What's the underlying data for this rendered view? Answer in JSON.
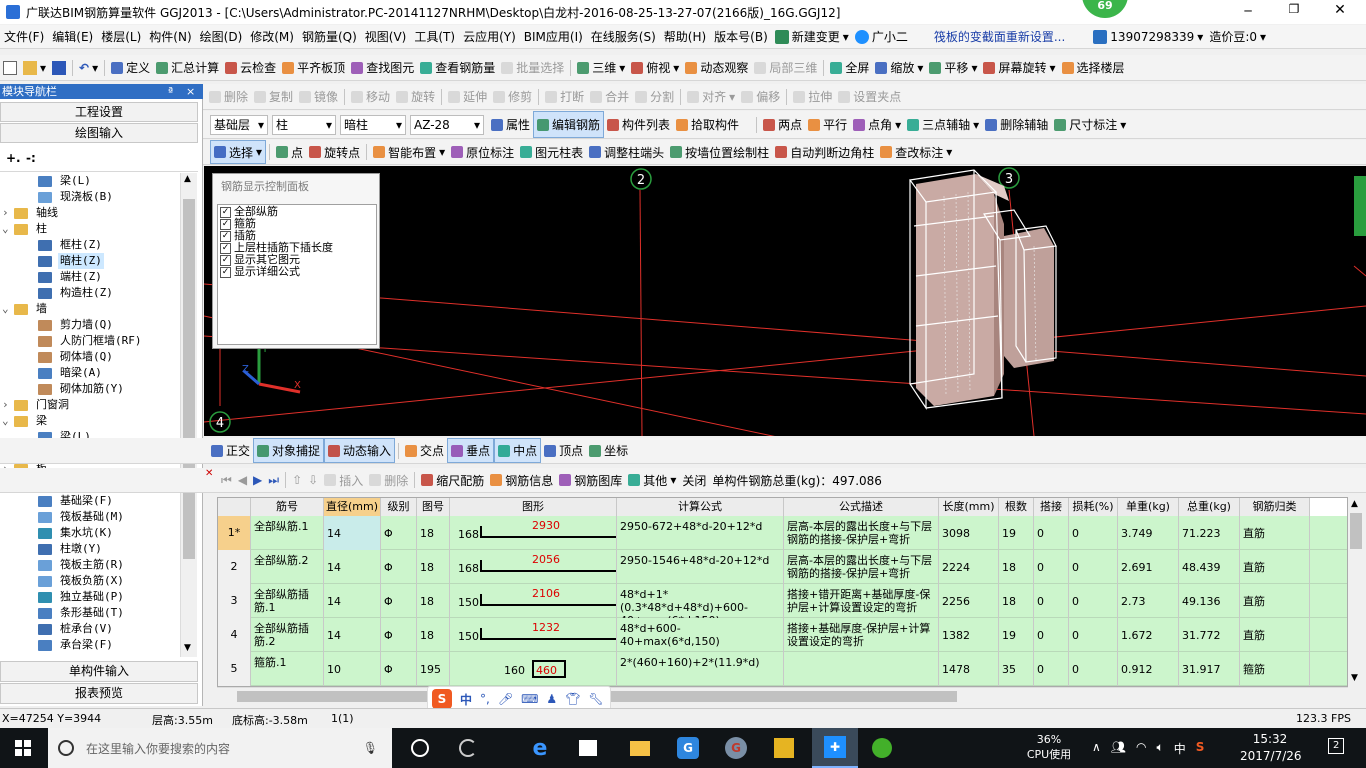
{
  "title": "广联达BIM钢筋算量软件 GGJ2013 - [C:\\Users\\Administrator.PC-20141127NRHM\\Desktop\\白龙村-2016-08-25-13-27-07(2166版)_16G.GGJ12]",
  "badge": "69",
  "menu": [
    "文件(F)",
    "编辑(E)",
    "楼层(L)",
    "构件(N)",
    "绘图(D)",
    "修改(M)",
    "钢筋量(Q)",
    "视图(V)",
    "工具(T)",
    "云应用(Y)",
    "BIM应用(I)",
    "在线服务(S)",
    "帮助(H)",
    "版本号(B)"
  ],
  "menu_new_change": "新建变更",
  "menu_assistant": "广小二",
  "menu_tip": "筏板的变截面重新设置...",
  "menu_phone": "13907298339",
  "menu_cost": "造价豆:0",
  "toolbar1": [
    "定义",
    "汇总计算",
    "云检查",
    "平齐板顶",
    "查找图元",
    "查看钢筋量",
    "批量选择",
    "三维",
    "俯视",
    "动态观察",
    "局部三维",
    "全屏",
    "缩放",
    "平移",
    "屏幕旋转",
    "选择楼层"
  ],
  "toolbar2": [
    "删除",
    "复制",
    "镜像",
    "移动",
    "旋转",
    "延伸",
    "修剪",
    "打断",
    "合并",
    "分割",
    "对齐",
    "偏移",
    "拉伸",
    "设置夹点"
  ],
  "toolbar3": {
    "floor": "基础层",
    "type": "柱",
    "sub": "暗柱",
    "name": "AZ-28",
    "items": [
      "属性",
      "编辑钢筋",
      "构件列表",
      "拾取构件"
    ],
    "items2": [
      "两点",
      "平行",
      "点角",
      "三点辅轴",
      "删除辅轴",
      "尺寸标注"
    ]
  },
  "toolbar4": [
    "选择",
    "点",
    "旋转点",
    "智能布置",
    "原位标注",
    "图元柱表",
    "调整柱端头",
    "按墙位置绘制柱",
    "自动判断边角柱",
    "查改标注"
  ],
  "nav": {
    "title": "模块导航栏",
    "pin": "ª",
    "close": "×",
    "btn1": "工程设置",
    "btn2": "绘图输入",
    "btn3": "单构件输入",
    "btn4": "报表预览"
  },
  "tree": [
    {
      "t": "梁(L)",
      "lvl": 3,
      "ico": "beam"
    },
    {
      "t": "现浇板(B)",
      "lvl": 3,
      "ico": "slab"
    },
    {
      "t": "轴线",
      "lvl": 1,
      "ico": "folder",
      "exp": "+"
    },
    {
      "t": "柱",
      "lvl": 1,
      "ico": "folder",
      "exp": "-"
    },
    {
      "t": "框柱(Z)",
      "lvl": 2,
      "ico": "col"
    },
    {
      "t": "暗柱(Z)",
      "lvl": 2,
      "ico": "col",
      "sel": true
    },
    {
      "t": "端柱(Z)",
      "lvl": 2,
      "ico": "col"
    },
    {
      "t": "构造柱(Z)",
      "lvl": 2,
      "ico": "col"
    },
    {
      "t": "墙",
      "lvl": 1,
      "ico": "folder",
      "exp": "-"
    },
    {
      "t": "剪力墙(Q)",
      "lvl": 2,
      "ico": "wall"
    },
    {
      "t": "人防门框墙(RF)",
      "lvl": 2,
      "ico": "wall"
    },
    {
      "t": "砌体墙(Q)",
      "lvl": 2,
      "ico": "wall"
    },
    {
      "t": "暗梁(A)",
      "lvl": 2,
      "ico": "beam"
    },
    {
      "t": "砌体加筋(Y)",
      "lvl": 2,
      "ico": "wall"
    },
    {
      "t": "门窗洞",
      "lvl": 1,
      "ico": "folder",
      "exp": "+"
    },
    {
      "t": "梁",
      "lvl": 1,
      "ico": "folder",
      "exp": "-"
    },
    {
      "t": "梁(L)",
      "lvl": 2,
      "ico": "beam"
    },
    {
      "t": "圈梁(E)",
      "lvl": 2,
      "ico": "beam"
    },
    {
      "t": "板",
      "lvl": 1,
      "ico": "folder",
      "exp": "+"
    },
    {
      "t": "基础",
      "lvl": 1,
      "ico": "folder",
      "exp": "-"
    },
    {
      "t": "基础梁(F)",
      "lvl": 2,
      "ico": "beam"
    },
    {
      "t": "筏板基础(M)",
      "lvl": 2,
      "ico": "slab"
    },
    {
      "t": "集水坑(K)",
      "lvl": 2,
      "ico": "pit"
    },
    {
      "t": "柱墩(Y)",
      "lvl": 2,
      "ico": "col"
    },
    {
      "t": "筏板主筋(R)",
      "lvl": 2,
      "ico": "slab"
    },
    {
      "t": "筏板负筋(X)",
      "lvl": 2,
      "ico": "slab"
    },
    {
      "t": "独立基础(P)",
      "lvl": 2,
      "ico": "pit"
    },
    {
      "t": "条形基础(T)",
      "lvl": 2,
      "ico": "beam"
    },
    {
      "t": "桩承台(V)",
      "lvl": 2,
      "ico": "col"
    },
    {
      "t": "承台梁(F)",
      "lvl": 2,
      "ico": "beam"
    }
  ],
  "panel": {
    "title": "钢筋显示控制面板",
    "items": [
      "全部纵筋",
      "箍筋",
      "插筋",
      "上层柱插筋下插长度",
      "显示其它图元",
      "显示详细公式"
    ]
  },
  "axis_labels": [
    "2",
    "3",
    "4"
  ],
  "snapbar": [
    "正交",
    "对象捕捉",
    "动态输入",
    "交点",
    "垂点",
    "中点",
    "顶点",
    "坐标"
  ],
  "gridbar": {
    "items": [
      "插入",
      "删除",
      "缩尺配筋",
      "钢筋信息",
      "钢筋图库",
      "其他",
      "关闭"
    ],
    "total": "单构件钢筋总重(kg)：497.086"
  },
  "columns": [
    "筋号",
    "直径(mm)",
    "级别",
    "图号",
    "图形",
    "计算公式",
    "公式描述",
    "长度(mm)",
    "根数",
    "搭接",
    "损耗(%)",
    "单重(kg)",
    "总重(kg)",
    "钢筋归类"
  ],
  "rows": [
    {
      "no": "1*",
      "name": "全部纵筋.1",
      "d": "14",
      "lvl": "Φ",
      "fig": "18",
      "s1": "168",
      "s2": "2930",
      "formula": "2950-672+48*d-20+12*d",
      "desc": "层高-本层的露出长度+与下层钢筋的搭接-保护层+弯折",
      "len": "3098",
      "cnt": "19",
      "lap": "0",
      "loss": "0",
      "uw": "3.749",
      "tw": "71.223",
      "cat": "直筋"
    },
    {
      "no": "2",
      "name": "全部纵筋.2",
      "d": "14",
      "lvl": "Φ",
      "fig": "18",
      "s1": "168",
      "s2": "2056",
      "formula": "2950-1546+48*d-20+12*d",
      "desc": "层高-本层的露出长度+与下层钢筋的搭接-保护层+弯折",
      "len": "2224",
      "cnt": "18",
      "lap": "0",
      "loss": "0",
      "uw": "2.691",
      "tw": "48.439",
      "cat": "直筋"
    },
    {
      "no": "3",
      "name": "全部纵筋插筋.1",
      "d": "14",
      "lvl": "Φ",
      "fig": "18",
      "s1": "150",
      "s2": "2106",
      "formula": "48*d+1*(0.3*48*d+48*d)+600-40+max(6*d,150)",
      "desc": "搭接+错开距离+基础厚度-保护层+计算设置设定的弯折",
      "len": "2256",
      "cnt": "18",
      "lap": "0",
      "loss": "0",
      "uw": "2.73",
      "tw": "49.136",
      "cat": "直筋"
    },
    {
      "no": "4",
      "name": "全部纵筋插筋.2",
      "d": "14",
      "lvl": "Φ",
      "fig": "18",
      "s1": "150",
      "s2": "1232",
      "formula": "48*d+600-40+max(6*d,150)",
      "desc": "搭接+基础厚度-保护层+计算设置设定的弯折",
      "len": "1382",
      "cnt": "19",
      "lap": "0",
      "loss": "0",
      "uw": "1.672",
      "tw": "31.772",
      "cat": "直筋"
    },
    {
      "no": "5",
      "name": "箍筋.1",
      "d": "10",
      "lvl": "Φ",
      "fig": "195",
      "s1": "160",
      "s2": "460",
      "formula": "2*(460+160)+2*(11.9*d)",
      "desc": "",
      "len": "1478",
      "cnt": "35",
      "lap": "0",
      "loss": "0",
      "uw": "0.912",
      "tw": "31.917",
      "cat": "箍筋"
    }
  ],
  "ime": "中",
  "status": {
    "coords": "X=47254 Y=3944",
    "floor_h": "层高:3.55m",
    "bottom_h": "底标高:-3.58m",
    "count": "1(1)",
    "fps": "123.3 FPS"
  },
  "taskbar": {
    "search": "在这里输入你要搜索的内容",
    "cpu": "36%",
    "cpu_label": "CPU使用",
    "time": "15:32",
    "date": "2017/7/26",
    "lang": "中",
    "notif": "2"
  },
  "colors": {
    "canvas": "#000000",
    "grid_red": "#e0302a",
    "green_row": "#ccf5cc",
    "selected_tree": "#cde8ff"
  }
}
